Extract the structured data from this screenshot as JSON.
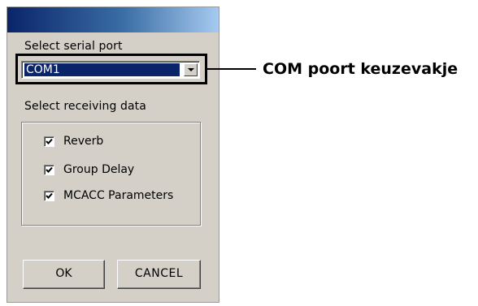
{
  "dialog": {
    "serial_port_label": "Select serial port",
    "serial_port_value": "COM1",
    "receiving_label": "Select receiving data",
    "options": [
      {
        "label": "Reverb",
        "checked": true
      },
      {
        "label": "Group Delay",
        "checked": true
      },
      {
        "label": "MCACC Parameters",
        "checked": true
      }
    ],
    "ok_label": "OK",
    "cancel_label": "CANCEL"
  },
  "callout": {
    "text": "COM poort keuzevakje"
  },
  "icons": {
    "dropdown": "chevron-down-icon",
    "check": "checkmark-icon"
  },
  "colors": {
    "selection": "#0a246a",
    "dialog_bg": "#d4d0c8"
  }
}
